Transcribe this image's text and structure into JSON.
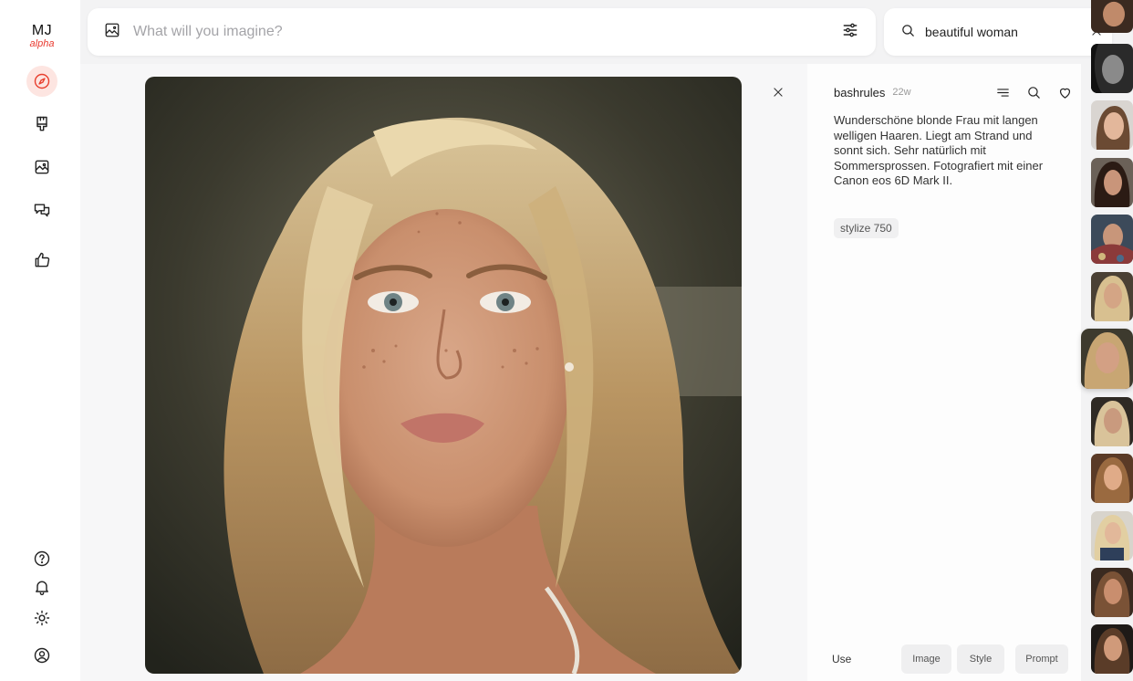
{
  "app": {
    "logo_line1": "MJ",
    "logo_line2": "alpha",
    "accent_color": "#e8402f"
  },
  "sidebar": {
    "top_items": [
      {
        "id": "explore",
        "icon": "compass-icon",
        "active": true
      },
      {
        "id": "create",
        "icon": "paintbrush-icon",
        "active": false
      },
      {
        "id": "organize",
        "icon": "image-icon",
        "active": false
      },
      {
        "id": "chat",
        "icon": "chat-icon",
        "active": false
      },
      {
        "id": "rank",
        "icon": "thumbs-up-icon",
        "active": false
      }
    ],
    "bottom_items": [
      {
        "id": "help",
        "icon": "help-icon"
      },
      {
        "id": "notifications",
        "icon": "bell-icon"
      },
      {
        "id": "theme",
        "icon": "sun-icon"
      },
      {
        "id": "account",
        "icon": "user-circle-icon"
      }
    ]
  },
  "imagine_bar": {
    "placeholder": "What will you imagine?",
    "icon": "image-icon",
    "settings_icon": "sliders-icon"
  },
  "search": {
    "value": "beautiful woman",
    "icon": "search-icon",
    "clear_icon": "close-icon"
  },
  "viewer": {
    "image_subject": "portrait of a blonde woman with freckles",
    "close_icon": "close-icon"
  },
  "details": {
    "author": "bashrules",
    "age": "22w",
    "actions": [
      "menu-icon",
      "search-icon",
      "heart-icon"
    ],
    "prompt": "Wunderschöne blonde Frau mit langen welligen Haaren. Liegt am Strand und sonnt sich. Sehr natürlich mit Sommersprossen. Fotografiert mit einer Canon eos 6D Mark II.",
    "params": [
      "stylize 750"
    ],
    "use_label": "Use",
    "use_buttons": [
      {
        "id": "image",
        "label": "Image"
      },
      {
        "id": "style",
        "label": "Style"
      },
      {
        "id": "prompt",
        "label": "Prompt"
      }
    ]
  },
  "thumbnails": {
    "count": 12,
    "selected_index": 6
  }
}
